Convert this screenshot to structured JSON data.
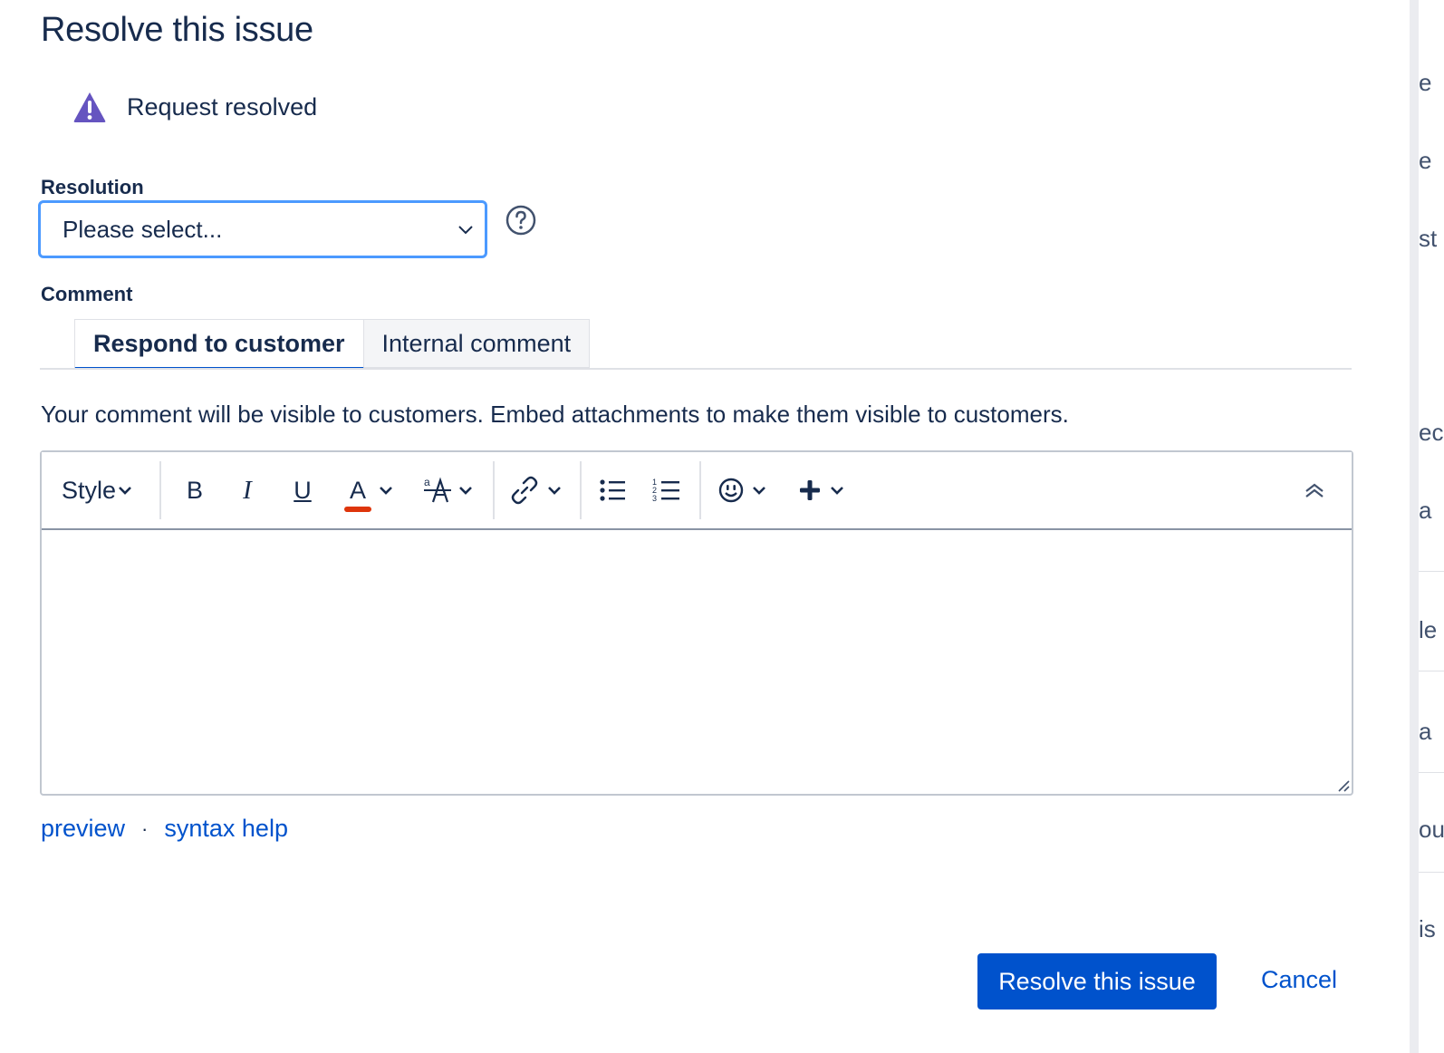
{
  "dialog": {
    "title": "Resolve this issue",
    "notice": {
      "icon": "warning-triangle-icon",
      "text": "Request resolved",
      "icon_color": "#6554c0"
    },
    "resolution": {
      "label": "Resolution",
      "selected": "Please select..."
    },
    "comment": {
      "label": "Comment",
      "tabs": [
        {
          "label": "Respond to customer",
          "active": true
        },
        {
          "label": "Internal comment",
          "active": false
        }
      ],
      "hint": "Your comment will be visible to customers. Embed attachments to make them visible to customers.",
      "toolbar": {
        "style_label": "Style",
        "bold": "B",
        "italic": "I",
        "underline": "U",
        "text_color": "A",
        "text_color_underline": "#de350b"
      },
      "body": ""
    },
    "links": {
      "preview": "preview",
      "separator": "·",
      "syntax_help": "syntax help"
    },
    "actions": {
      "primary": "Resolve this issue",
      "cancel": "Cancel"
    }
  },
  "colors": {
    "primary": "#0052cc",
    "focus": "#4c9aff",
    "text": "#172b4d"
  },
  "side_fragments": [
    "e",
    "e",
    "st",
    "ec",
    "a",
    "le",
    "a",
    "ou",
    "is"
  ]
}
